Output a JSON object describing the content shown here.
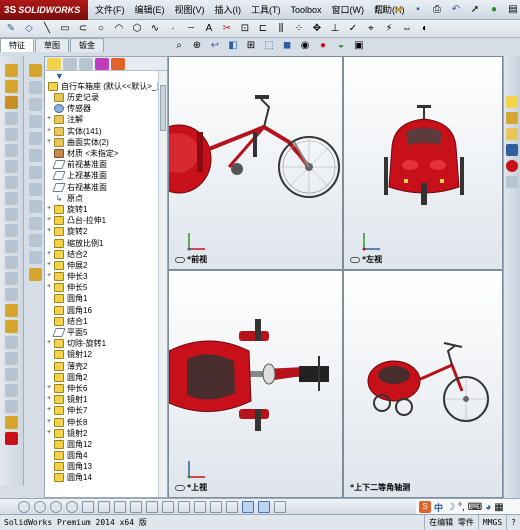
{
  "app": {
    "brand": "SOLIDWORKS",
    "brand_prefix": "3S"
  },
  "menus": [
    "文件(F)",
    "编辑(E)",
    "视图(V)",
    "插入(I)",
    "工具(T)",
    "Toolbox",
    "窗口(W)",
    "帮助(H)"
  ],
  "manager_tabs": [
    "特征",
    "草图",
    "钣金"
  ],
  "tree": {
    "root": "自行车箱座 (默认<<默认>_显示...",
    "items": [
      {
        "label": "历史记录",
        "icon": "history-icon",
        "kind": "folder",
        "expand": ""
      },
      {
        "label": "传感器",
        "icon": "sensor-icon",
        "kind": "sensor",
        "expand": ""
      },
      {
        "label": "注解",
        "icon": "annotation-icon",
        "kind": "folder",
        "expand": "+"
      },
      {
        "label": "实体(141)",
        "icon": "solid-bodies-icon",
        "kind": "folder",
        "expand": "+"
      },
      {
        "label": "曲面实体(2)",
        "icon": "surface-bodies-icon",
        "kind": "folder",
        "expand": "+"
      },
      {
        "label": "材质 <未指定>",
        "icon": "material-icon",
        "kind": "mat",
        "expand": ""
      },
      {
        "label": "前视基准面",
        "icon": "plane-icon",
        "kind": "plane",
        "expand": ""
      },
      {
        "label": "上视基准面",
        "icon": "plane-icon",
        "kind": "plane",
        "expand": ""
      },
      {
        "label": "右视基准面",
        "icon": "plane-icon",
        "kind": "plane",
        "expand": ""
      },
      {
        "label": "原点",
        "icon": "origin-icon",
        "kind": "origin",
        "expand": ""
      },
      {
        "label": "旋转1",
        "icon": "revolve-icon",
        "kind": "feat",
        "expand": "+"
      },
      {
        "label": "凸台-拉伸1",
        "icon": "extrude-icon",
        "kind": "feat",
        "expand": "+"
      },
      {
        "label": "旋转2",
        "icon": "revolve-icon",
        "kind": "feat",
        "expand": "+"
      },
      {
        "label": "缩放比例1",
        "icon": "scale-icon",
        "kind": "feat",
        "expand": ""
      },
      {
        "label": "结合2",
        "icon": "combine-icon",
        "kind": "feat",
        "expand": "+"
      },
      {
        "label": "伸展2",
        "icon": "extrude-icon",
        "kind": "feat",
        "expand": "+"
      },
      {
        "label": "伸长3",
        "icon": "extrude-icon",
        "kind": "feat",
        "expand": "+"
      },
      {
        "label": "伸长5",
        "icon": "extrude-icon",
        "kind": "feat",
        "expand": "+"
      },
      {
        "label": "圆角1",
        "icon": "fillet-icon",
        "kind": "feat",
        "expand": ""
      },
      {
        "label": "圆角16",
        "icon": "fillet-icon",
        "kind": "feat",
        "expand": ""
      },
      {
        "label": "结合1",
        "icon": "combine-icon",
        "kind": "feat",
        "expand": ""
      },
      {
        "label": "平面5",
        "icon": "plane-icon",
        "kind": "plane",
        "expand": ""
      },
      {
        "label": "切除-旋转1",
        "icon": "cut-revolve-icon",
        "kind": "feat",
        "expand": "+"
      },
      {
        "label": "镜射12",
        "icon": "mirror-icon",
        "kind": "feat",
        "expand": ""
      },
      {
        "label": "薄壳2",
        "icon": "shell-icon",
        "kind": "feat",
        "expand": ""
      },
      {
        "label": "圆角2",
        "icon": "fillet-icon",
        "kind": "feat",
        "expand": ""
      },
      {
        "label": "伸长6",
        "icon": "extrude-icon",
        "kind": "feat",
        "expand": "+"
      },
      {
        "label": "镜射1",
        "icon": "mirror-icon",
        "kind": "feat",
        "expand": "+"
      },
      {
        "label": "伸长7",
        "icon": "extrude-icon",
        "kind": "feat",
        "expand": "+"
      },
      {
        "label": "伸长8",
        "icon": "extrude-icon",
        "kind": "feat",
        "expand": "+"
      },
      {
        "label": "镜射2",
        "icon": "mirror-icon",
        "kind": "feat",
        "expand": "+"
      },
      {
        "label": "圆角12",
        "icon": "fillet-icon",
        "kind": "feat",
        "expand": ""
      },
      {
        "label": "圆角4",
        "icon": "fillet-icon",
        "kind": "feat",
        "expand": ""
      },
      {
        "label": "圆角13",
        "icon": "fillet-icon",
        "kind": "feat",
        "expand": ""
      },
      {
        "label": "圆角14",
        "icon": "fillet-icon",
        "kind": "feat",
        "expand": ""
      }
    ]
  },
  "viewports": [
    {
      "label": "*前视",
      "id": "front"
    },
    {
      "label": "*左视",
      "id": "left"
    },
    {
      "label": "*上视",
      "id": "top"
    },
    {
      "label": "*上下二等角轴测",
      "id": "dimetric"
    }
  ],
  "ime": {
    "label": "中"
  },
  "status": {
    "app_version": "SolidWorks Premium 2014 x64 版",
    "mode": "在编辑 零件",
    "units": "MMGS"
  },
  "colors": {
    "model_red": "#c8101a",
    "frame_red": "#b5121b",
    "accent_blue": "#2f5f9c"
  }
}
